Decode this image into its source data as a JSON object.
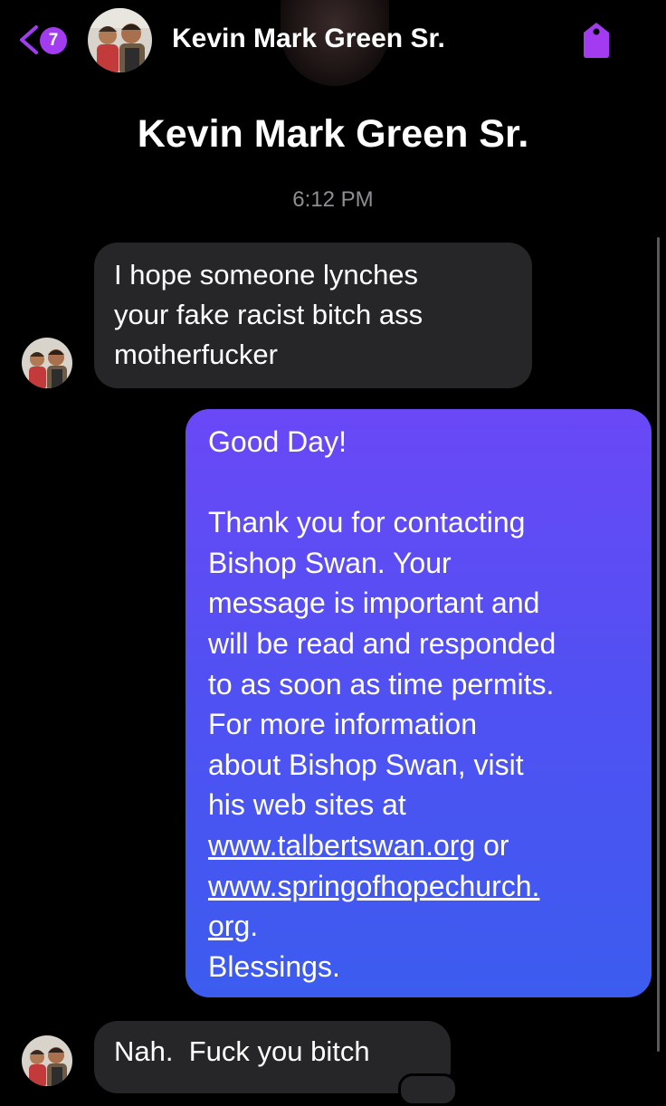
{
  "header": {
    "back_count": "7",
    "contact_name": "Kevin Mark Green Sr."
  },
  "profile": {
    "name": "Kevin Mark Green Sr."
  },
  "timestamp": "6:12 PM",
  "messages": [
    {
      "direction": "incoming",
      "lines": [
        "I hope someone lynches",
        "your fake racist bitch ass",
        "motherfucker"
      ]
    },
    {
      "direction": "outgoing",
      "greeting": "Good Day!",
      "lines": [
        "Thank you for contacting",
        "Bishop Swan. Your",
        "message is important and",
        "will be read and responded",
        "to as soon as time permits.",
        "For more information",
        "about Bishop Swan, visit",
        "his web sites at"
      ],
      "link1": "www.talbertswan.org",
      "link_joiner": " or",
      "link2_part1": "www.springofhopechurch.",
      "link2_part2": "org",
      "link2_suffix": ".",
      "closing": "Blessings."
    },
    {
      "direction": "incoming",
      "text": "Nah.  Fuck you bitch"
    }
  ],
  "colors": {
    "background": "#000000",
    "accent": "#a33cf0",
    "incoming_bubble": "#262629",
    "outgoing_gradient_top": "#6a48f6",
    "outgoing_gradient_bottom": "#3c5cf0",
    "timestamp": "#8e8e93"
  },
  "icons": {
    "back": "chevron-left-icon",
    "tag": "tag-icon",
    "avatar": "contact-avatar"
  }
}
